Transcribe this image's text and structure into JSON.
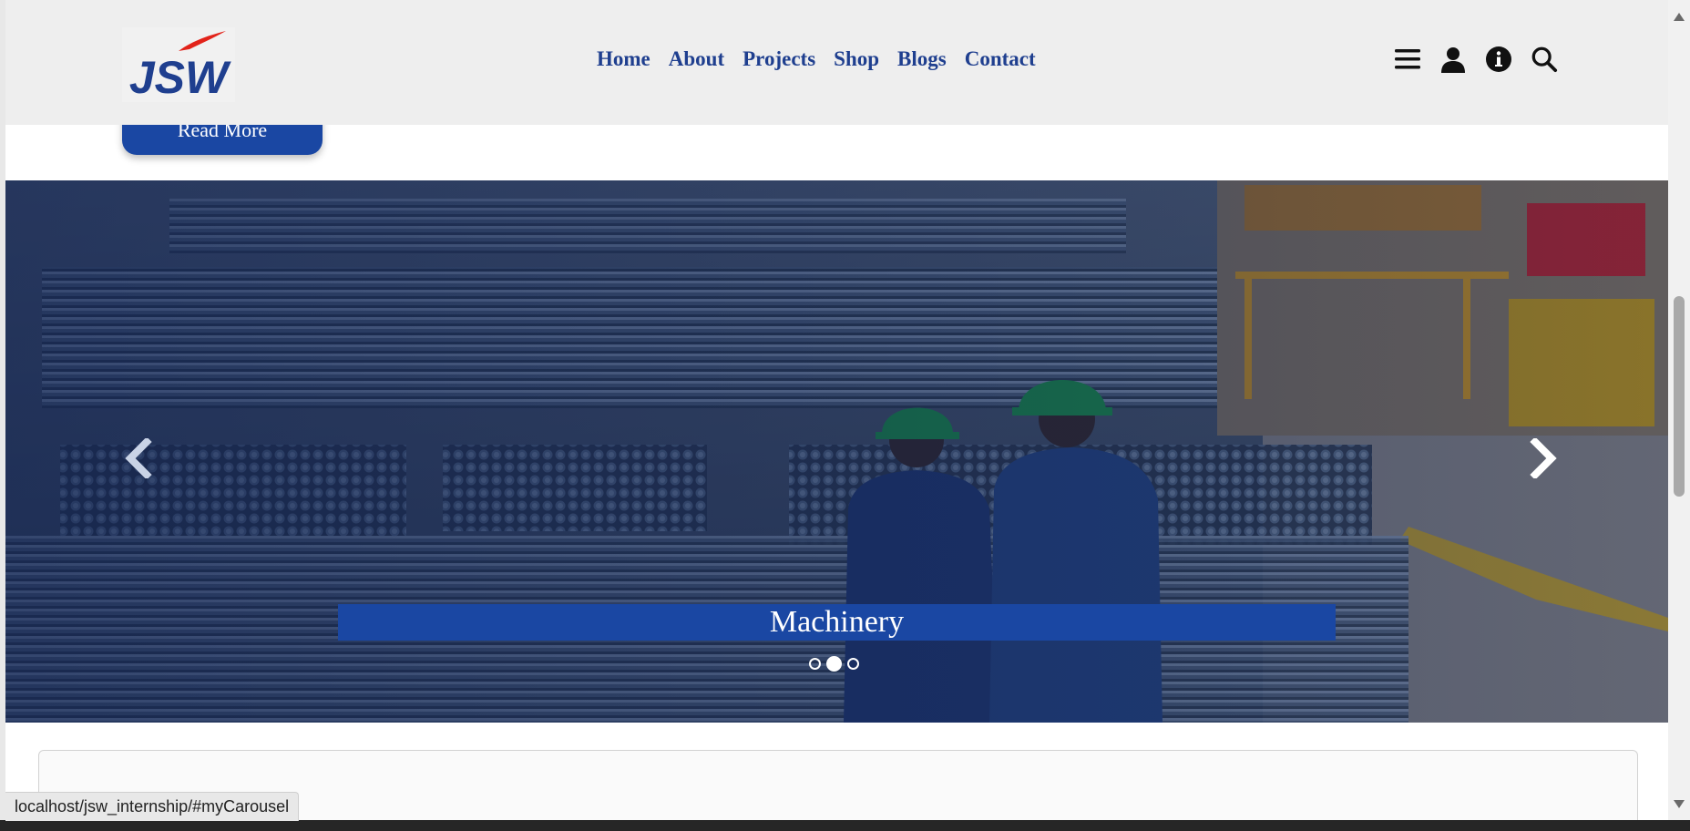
{
  "header": {
    "logo_text": "JSW",
    "nav": [
      "Home",
      "About",
      "Projects",
      "Shop",
      "Blogs",
      "Contact"
    ],
    "icons": [
      "menu-icon",
      "user-icon",
      "info-icon",
      "search-icon"
    ]
  },
  "hero": {
    "read_more_label": "Read More"
  },
  "carousel": {
    "caption": "Machinery",
    "slide_count": 3,
    "active_index": 1
  },
  "status_bar": {
    "url": "localhost/jsw_internship/#myCarousel"
  },
  "colors": {
    "brand_blue": "#1a47a3",
    "nav_text": "#1f3f8f",
    "header_bg": "#eeeeee",
    "logo_red": "#e2231a"
  }
}
